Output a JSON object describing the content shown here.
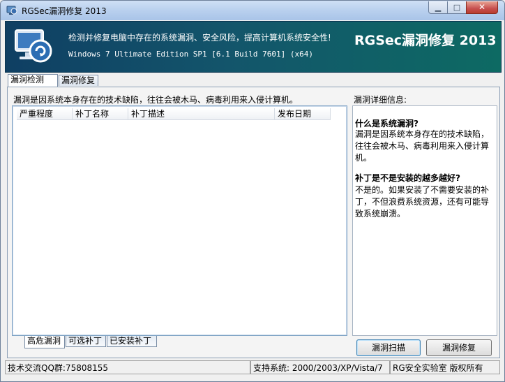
{
  "window": {
    "title": "RGSec漏洞修复 2013"
  },
  "banner": {
    "line1": "检测并修复电脑中存在的系统漏洞、安全风险，提高计算机系统安全性!",
    "line2": "Windows 7 Ultimate Edition SP1 [6.1 Build 7601] (x64)",
    "product_title": "RGSec漏洞修复 2013"
  },
  "top_tabs": [
    "漏洞检测",
    "漏洞修复"
  ],
  "left_description": "漏洞是因系统本身存在的技术缺陷，往往会被木马、病毒利用来入侵计算机。",
  "list_columns": [
    "严重程度",
    "补丁名称",
    "补丁描述",
    "发布日期"
  ],
  "bottom_tabs": [
    "高危漏洞",
    "可选补丁",
    "已安装补丁"
  ],
  "details": {
    "title": "漏洞详细信息:",
    "q1": "什么是系统漏洞?",
    "a1_l1": "漏洞是因系统本身存在的技术缺陷，",
    "a1_l2": "往往会被木马、病毒利用来入侵计算",
    "a1_l3": "机。",
    "q2": "补丁是不是安装的越多越好?",
    "a2_l1": "不是的。如果安装了不需要安装的补",
    "a2_l2": "丁，不但浪费系统资源，还有可能导",
    "a2_l3": "致系统崩溃。"
  },
  "buttons": {
    "scan": "漏洞扫描",
    "repair": "漏洞修复"
  },
  "status": {
    "qq": "技术交流QQ群:75808155",
    "support": "支持系统: 2000/2003/XP/Vista/7",
    "copyright": "RG安全实验室 版权所有"
  },
  "colors": {
    "banner_start": "#0f3f63",
    "banner_end": "#0d6a63",
    "close_button": "#c75050"
  }
}
